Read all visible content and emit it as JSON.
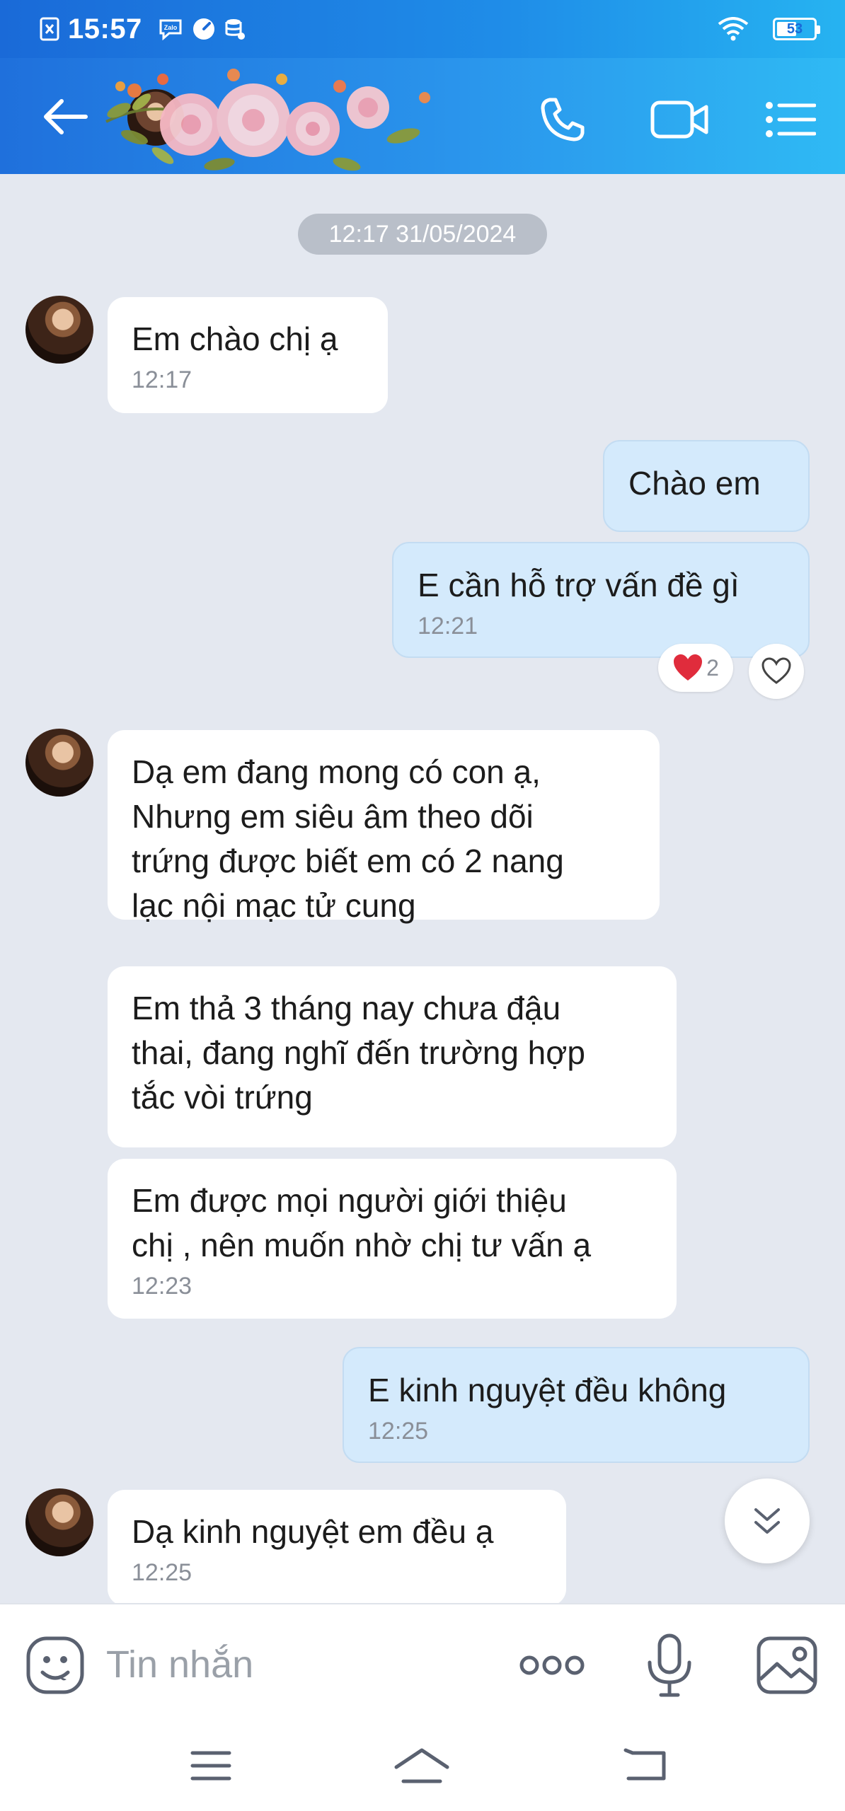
{
  "status_bar": {
    "time": "15:57",
    "battery": "53",
    "icons": [
      "sim-x-icon",
      "zalo-icon",
      "speed-icon",
      "database-icon",
      "wifi-icon",
      "battery-icon"
    ]
  },
  "header": {
    "icons": [
      "back-arrow-icon",
      "phone-icon",
      "video-camera-icon",
      "list-menu-icon"
    ],
    "colors": {
      "gradient_start": "#1f70dc",
      "gradient_end": "#2fbaf4"
    }
  },
  "chat": {
    "date_separator": "12:17 31/05/2024",
    "messages": [
      {
        "side": "in",
        "lines": [
          "Em chào chị ạ"
        ],
        "time": "12:17"
      },
      {
        "side": "out",
        "lines": [
          "Chào em"
        ],
        "time": ""
      },
      {
        "side": "out",
        "lines": [
          "E cần hỗ trợ vấn đề gì"
        ],
        "time": "12:21",
        "reaction": {
          "emoji": "❤️",
          "count": "2"
        }
      },
      {
        "side": "in",
        "lines": [
          "Dạ em đang mong có con ạ,",
          "Nhưng em siêu âm theo dõi",
          "trứng được biết em có 2 nang",
          "lạc nội mạc tử cung"
        ],
        "time": ""
      },
      {
        "side": "in",
        "lines": [
          "Em thả 3 tháng nay chưa đậu",
          "thai, đang nghĩ đến trường hợp",
          "tắc vòi trứng"
        ],
        "time": ""
      },
      {
        "side": "in",
        "lines": [
          "Em được mọi người giới thiệu",
          "chị , nên muốn nhờ chị tư vấn ạ"
        ],
        "time": "12:23"
      },
      {
        "side": "out",
        "lines": [
          "E kinh nguyệt đều không"
        ],
        "time": "12:25"
      },
      {
        "side": "in",
        "lines": [
          "Dạ kinh nguyệt em đều ạ"
        ],
        "time": "12:25"
      }
    ]
  },
  "composer": {
    "placeholder": "Tin nhắn",
    "icons": [
      "emoji-icon",
      "more-dots-icon",
      "microphone-icon",
      "image-icon"
    ]
  },
  "navbar": {
    "icons": [
      "recent-apps-icon",
      "home-icon",
      "back-icon"
    ]
  },
  "colors": {
    "chat_background": "#e4e8f0",
    "incoming_bubble": "#ffffff",
    "outgoing_bubble": "#d4eafc",
    "reaction_heart": "#e02c3c"
  }
}
